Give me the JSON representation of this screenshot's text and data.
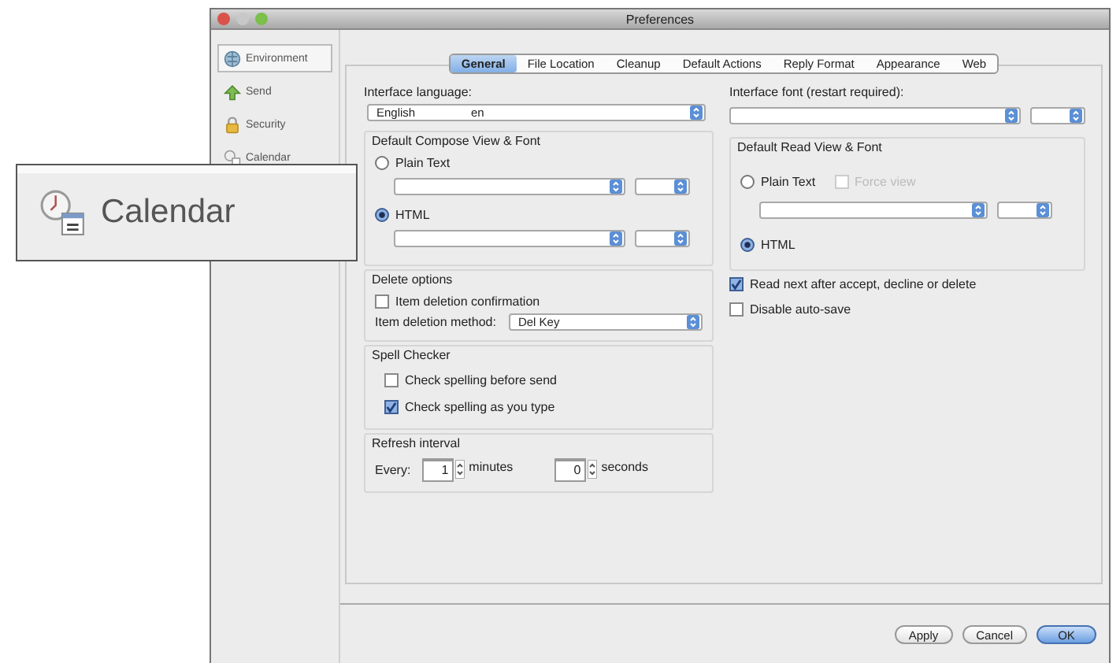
{
  "window": {
    "title": "Preferences"
  },
  "sidebar": {
    "items": [
      {
        "label": "Environment",
        "kind": "environment",
        "selected": true
      },
      {
        "label": "Send",
        "kind": "send",
        "selected": false
      },
      {
        "label": "Security",
        "kind": "security",
        "selected": false
      },
      {
        "label": "Calendar",
        "kind": "calendar",
        "selected": false
      }
    ]
  },
  "tabs": [
    {
      "label": "General",
      "selected": true
    },
    {
      "label": "File Location",
      "selected": false
    },
    {
      "label": "Cleanup",
      "selected": false
    },
    {
      "label": "Default Actions",
      "selected": false
    },
    {
      "label": "Reply Format",
      "selected": false
    },
    {
      "label": "Appearance",
      "selected": false
    },
    {
      "label": "Web",
      "selected": false
    }
  ],
  "interface_language": {
    "label": "Interface language:",
    "value": "English",
    "code": "en"
  },
  "default_compose": {
    "title": "Default Compose View & Font",
    "options": [
      {
        "label": "Plain Text",
        "selected": false
      },
      {
        "label": "HTML",
        "selected": true
      }
    ]
  },
  "delete_options": {
    "title": "Delete options",
    "confirmation": {
      "label": "Item deletion confirmation",
      "checked": false
    },
    "method_label": "Item deletion method:",
    "method_value": "Del Key"
  },
  "spell_checker": {
    "title": "Spell Checker",
    "options": [
      {
        "label": "Check spelling before send",
        "checked": false
      },
      {
        "label": "Check spelling as you type",
        "checked": true
      }
    ]
  },
  "refresh_interval": {
    "title": "Refresh interval",
    "every_label": "Every:",
    "minutes_value": "1",
    "minutes_label": "minutes",
    "seconds_value": "0",
    "seconds_label": "seconds"
  },
  "interface_font": {
    "label": "Interface font (restart required):"
  },
  "default_read": {
    "title": "Default Read View & Font",
    "options": [
      {
        "label": "Plain Text",
        "selected": false
      },
      {
        "label": "HTML",
        "selected": true
      }
    ],
    "force_view": {
      "label": "Force view",
      "checked": false,
      "disabled": true
    }
  },
  "read_options": [
    {
      "label": "Read next after accept, decline or delete",
      "checked": true
    },
    {
      "label": "Disable auto-save",
      "checked": false
    }
  ],
  "buttons": [
    {
      "label": "Apply",
      "default": false
    },
    {
      "label": "Cancel",
      "default": false
    },
    {
      "label": "OK",
      "default": true
    }
  ],
  "callout": {
    "label": "Calendar"
  }
}
